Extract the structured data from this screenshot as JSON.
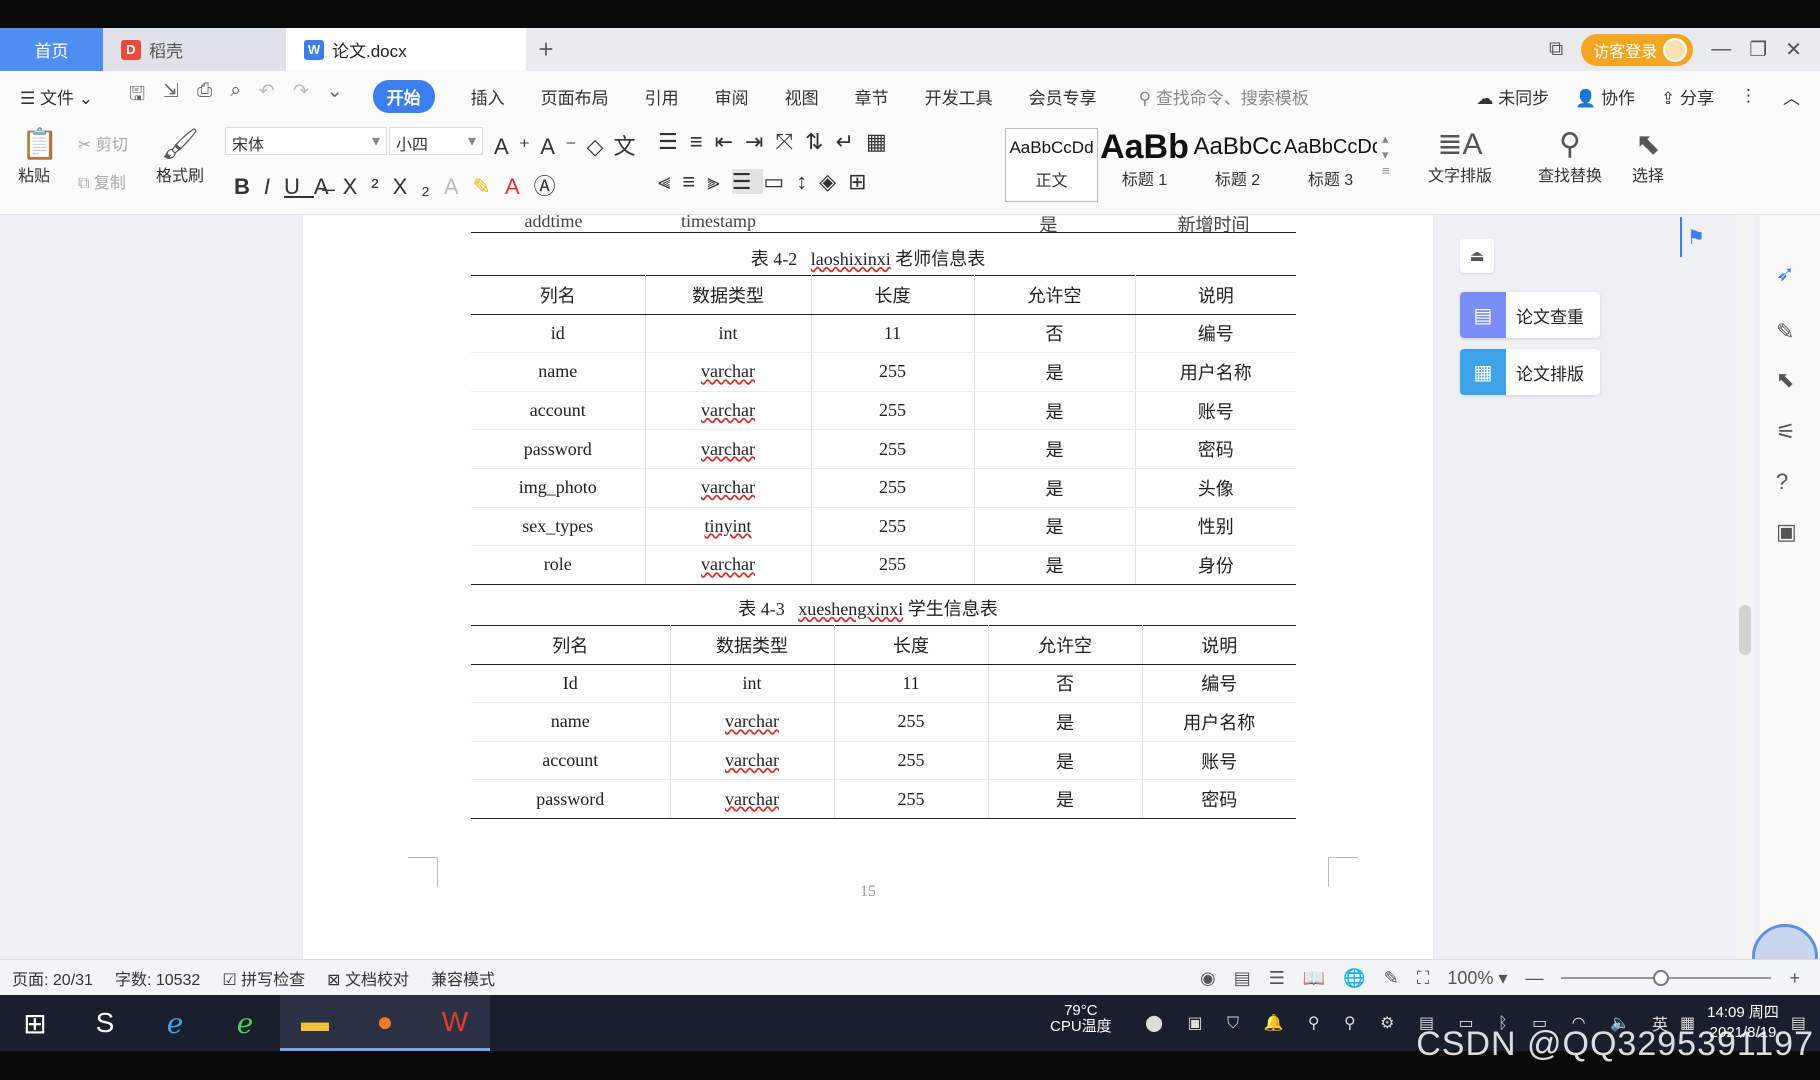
{
  "tabs": {
    "home": "首页",
    "daoke": "稻壳",
    "doc": "论文.docx",
    "add": "+",
    "login": "访客登录"
  },
  "menu": {
    "file": "文件",
    "items": [
      "开始",
      "插入",
      "页面布局",
      "引用",
      "审阅",
      "视图",
      "章节",
      "开发工具",
      "会员专享"
    ],
    "search": "查找命令、搜索模板",
    "unsync": "未同步",
    "collab": "协作",
    "share": "分享"
  },
  "ribbon": {
    "paste": "粘贴",
    "cut": "剪切",
    "copy": "复制",
    "format_painter": "格式刷",
    "font_name": "宋体",
    "font_size": "小四",
    "styles": [
      {
        "sample": "AaBbCcDd",
        "name": "正文"
      },
      {
        "sample": "AaBb",
        "name": "标题 1"
      },
      {
        "sample": "AaBbCc",
        "name": "标题 2"
      },
      {
        "sample": "AaBbCcDd",
        "name": "标题 3"
      }
    ],
    "text_layout": "文字排版",
    "find_replace": "查找替换",
    "select": "选择"
  },
  "document": {
    "prev_row": [
      "addtime",
      "timestamp",
      "",
      "是",
      "新增时间"
    ],
    "table1": {
      "caption_prefix": "表 4-2",
      "caption_code": "laoshixinxi",
      "caption_suffix": "老师信息表",
      "headers": [
        "列名",
        "数据类型",
        "长度",
        "允许空",
        "说明"
      ],
      "rows": [
        [
          "id",
          "int",
          "11",
          "否",
          "编号"
        ],
        [
          "name",
          "varchar",
          "255",
          "是",
          "用户名称"
        ],
        [
          "account",
          "varchar",
          "255",
          "是",
          "账号"
        ],
        [
          "password",
          "varchar",
          "255",
          "是",
          "密码"
        ],
        [
          "img_photo",
          "varchar",
          "255",
          "是",
          "头像"
        ],
        [
          "sex_types",
          "tinyint",
          "255",
          "是",
          "性别"
        ],
        [
          "role",
          "varchar",
          "255",
          "是",
          "身份"
        ]
      ]
    },
    "table2": {
      "caption_prefix": "表 4-3",
      "caption_code": "xueshengxinxi",
      "caption_suffix": "学生信息表",
      "headers": [
        "列名",
        "数据类型",
        "长度",
        "允许空",
        "说明"
      ],
      "rows": [
        [
          "Id",
          "int",
          "11",
          "否",
          "编号"
        ],
        [
          "name",
          "varchar",
          "255",
          "是",
          "用户名称"
        ],
        [
          "account",
          "varchar",
          "255",
          "是",
          "账号"
        ],
        [
          "password",
          "varchar",
          "255",
          "是",
          "密码"
        ]
      ]
    },
    "page_number": "15"
  },
  "side_panel": {
    "check": "论文查重",
    "format": "论文排版"
  },
  "status": {
    "page": "页面: 20/31",
    "words": "字数: 10532",
    "spell": "拼写检查",
    "proof": "文档校对",
    "compat": "兼容模式",
    "zoom": "100%"
  },
  "taskbar": {
    "cpu_temp": "79°C",
    "cpu_label": "CPU温度",
    "time": "14:09 周四",
    "date": "2021/8/19",
    "ime": "英"
  },
  "watermark": "CSDN @QQ3295391197",
  "colors": {
    "accent": "#3a7ef0",
    "home_tab": "#4f8df0",
    "login": "#f4a623"
  }
}
